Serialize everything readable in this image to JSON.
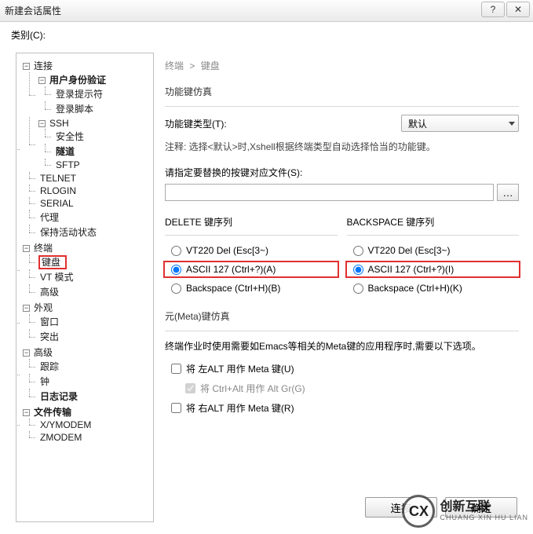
{
  "titlebar": {
    "title": "新建会话属性",
    "help": "?",
    "close": "✕"
  },
  "category_label": "类别(C):",
  "tree": {
    "connection": "连接",
    "auth": "用户身份验证",
    "login_prompt": "登录提示符",
    "login_script": "登录脚本",
    "ssh": "SSH",
    "security": "安全性",
    "tunnel": "隧道",
    "sftp": "SFTP",
    "telnet": "TELNET",
    "rlogin": "RLOGIN",
    "serial": "SERIAL",
    "proxy": "代理",
    "keepalive": "保持活动状态",
    "terminal": "终端",
    "keyboard": "键盘",
    "vtmode": "VT 模式",
    "advanced": "高级",
    "appearance": "外观",
    "window": "窗口",
    "highlight": "突出",
    "advanced2": "高级",
    "trace": "跟踪",
    "bell": "钟",
    "logging": "日志记录",
    "file_transfer": "文件传输",
    "xymodem": "X/YMODEM",
    "zmodem": "ZMODEM"
  },
  "breadcrumb": {
    "a": "终端",
    "b": "键盘"
  },
  "fn": {
    "title": "功能键仿真",
    "type_label": "功能键类型(T):",
    "type_value": "默认",
    "hint": "注释: 选择<默认>时,Xshell根据终端类型自动选择恰当的功能键。"
  },
  "mapfile": {
    "label": "请指定要替换的按键对应文件(S):",
    "value": ""
  },
  "delete": {
    "title": "DELETE 键序列",
    "opt1": "VT220 Del (Esc[3~)",
    "opt2": "ASCII 127 (Ctrl+?)(A)",
    "opt3": "Backspace (Ctrl+H)(B)"
  },
  "backspace": {
    "title": "BACKSPACE 键序列",
    "opt1": "VT220 Del (Esc[3~)",
    "opt2": "ASCII 127 (Ctrl+?)(I)",
    "opt3": "Backspace (Ctrl+H)(K)"
  },
  "meta": {
    "title": "元(Meta)键仿真",
    "desc": "终端作业时使用需要如Emacs等相关的Meta键的应用程序时,需要以下选项。",
    "left_alt": "将 左ALT 用作 Meta 键(U)",
    "ctrl_alt": "将 Ctrl+Alt 用作 Alt Gr(G)",
    "right_alt": "将 右ALT 用作 Meta 键(R)"
  },
  "buttons": {
    "connect": "连接",
    "ok": "确定"
  },
  "watermark": {
    "logo": "CX",
    "name": "创新互联",
    "sub": "CHUANG XIN HU LIAN"
  }
}
